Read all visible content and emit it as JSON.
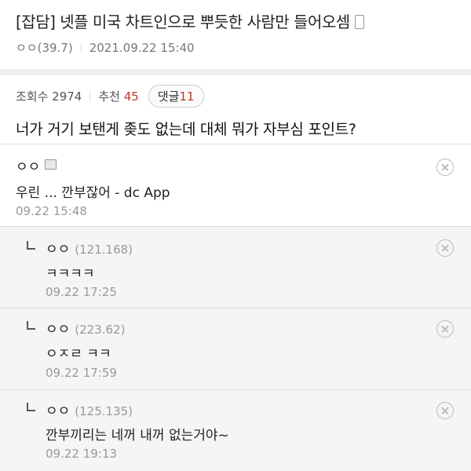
{
  "post": {
    "title": "[잡담] 넷플 미국 차트인으로 뿌듯한 사람만 들어오셈",
    "author": "ㅇㅇ(39.7)",
    "date": "2021.09.22 15:40",
    "views_label": "조회수 2974",
    "recommend_label": "추천",
    "recommend_count": "45",
    "comment_label": "댓글",
    "comment_count": "11",
    "body": "너가 거기 보탠게 좆도 없는데 대체 뭐가 자부심 포인트?"
  },
  "comments": [
    {
      "author": "ㅇㅇ",
      "ip": "",
      "text": "우린 ... 깐부잖어 - dc App",
      "time": "09.22 15:48"
    },
    {
      "author": "ㅇㅇ",
      "ip": "(121.168)",
      "text": "ㅋㅋㅋㅋ",
      "time": "09.22 17:25"
    },
    {
      "author": "ㅇㅇ",
      "ip": "(223.62)",
      "text": "ㅇㅈㄹ ㅋㅋ",
      "time": "09.22 17:59"
    },
    {
      "author": "ㅇㅇ",
      "ip": "(125.135)",
      "text": "깐부끼리는 네꺼 내꺼 없는거야~",
      "time": "09.22 19:13"
    }
  ],
  "icons": {
    "phone": "phone-icon",
    "delete": "close-circle-icon",
    "reply": "reply-arrow-icon",
    "mobile_badge": "mobile-badge-icon"
  },
  "colors": {
    "accent_red": "#c0392b",
    "reply_bg": "#f5f5f5"
  }
}
